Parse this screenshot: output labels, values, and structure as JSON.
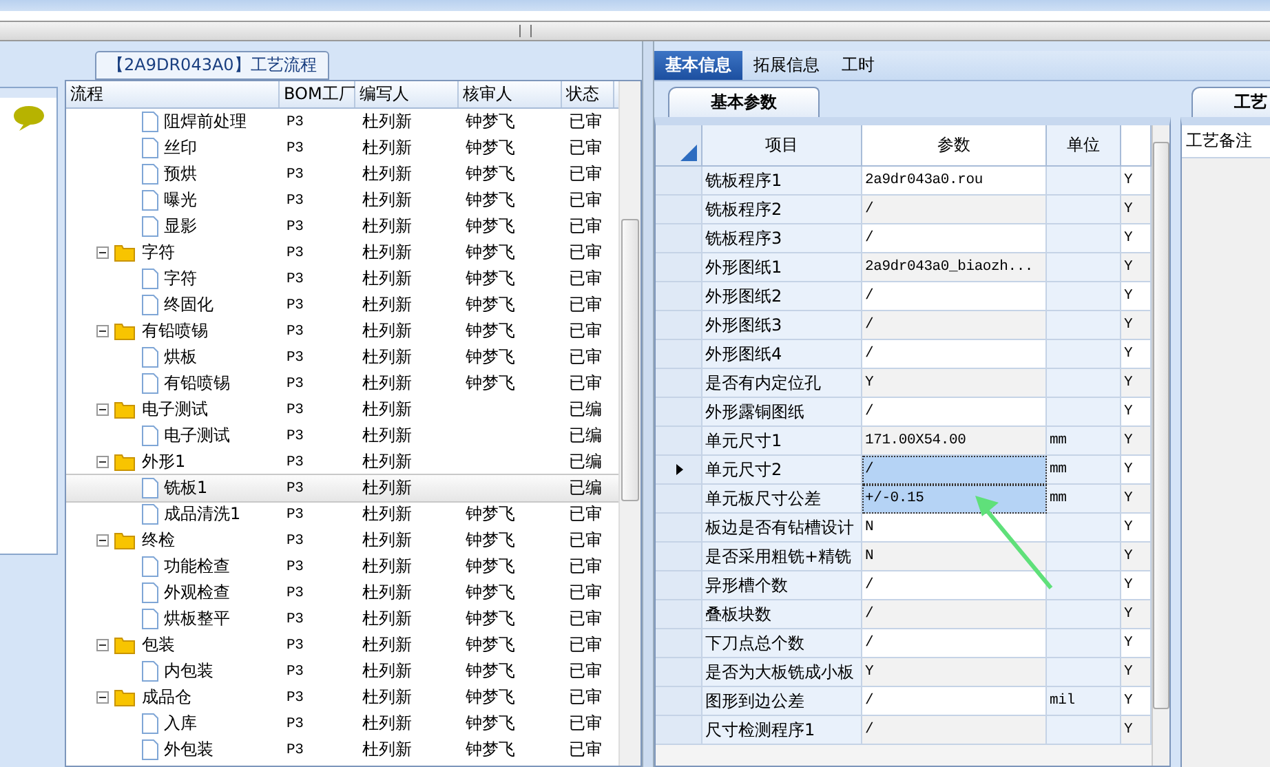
{
  "flow_panel": {
    "title": "【2A9DR043A0】工艺流程",
    "columns": [
      "流程",
      "BOM工厂",
      "编写人",
      "核审人",
      "状态"
    ],
    "continued_children": [
      {
        "name": "阻焊前处理",
        "bom": "P3",
        "writer": "杜列新",
        "reviewer": "钟梦飞",
        "status": "已审",
        "selected": false
      },
      {
        "name": "丝印",
        "bom": "P3",
        "writer": "杜列新",
        "reviewer": "钟梦飞",
        "status": "已审",
        "selected": false
      },
      {
        "name": "预烘",
        "bom": "P3",
        "writer": "杜列新",
        "reviewer": "钟梦飞",
        "status": "已审",
        "selected": false
      },
      {
        "name": "曝光",
        "bom": "P3",
        "writer": "杜列新",
        "reviewer": "钟梦飞",
        "status": "已审",
        "selected": false
      },
      {
        "name": "显影",
        "bom": "P3",
        "writer": "杜列新",
        "reviewer": "钟梦飞",
        "status": "已审",
        "selected": false
      }
    ],
    "groups": [
      {
        "name": "字符",
        "bom": "P3",
        "writer": "杜列新",
        "reviewer": "钟梦飞",
        "status": "已审",
        "expanded": true,
        "children": [
          {
            "name": "字符",
            "bom": "P3",
            "writer": "杜列新",
            "reviewer": "钟梦飞",
            "status": "已审",
            "selected": false
          },
          {
            "name": "终固化",
            "bom": "P3",
            "writer": "杜列新",
            "reviewer": "钟梦飞",
            "status": "已审",
            "selected": false
          }
        ]
      },
      {
        "name": "有铅喷锡",
        "bom": "P3",
        "writer": "杜列新",
        "reviewer": "钟梦飞",
        "status": "已审",
        "expanded": true,
        "children": [
          {
            "name": "烘板",
            "bom": "P3",
            "writer": "杜列新",
            "reviewer": "钟梦飞",
            "status": "已审",
            "selected": false
          },
          {
            "name": "有铅喷锡",
            "bom": "P3",
            "writer": "杜列新",
            "reviewer": "钟梦飞",
            "status": "已审",
            "selected": false
          }
        ]
      },
      {
        "name": "电子测试",
        "bom": "P3",
        "writer": "杜列新",
        "status": "已编",
        "expanded": true,
        "children": [
          {
            "name": "电子测试",
            "bom": "P3",
            "writer": "杜列新",
            "status": "已编",
            "selected": false
          }
        ]
      },
      {
        "name": "外形1",
        "bom": "P3",
        "writer": "杜列新",
        "status": "已编",
        "expanded": true,
        "children": [
          {
            "name": "铣板1",
            "bom": "P3",
            "writer": "杜列新",
            "status": "已编",
            "selected": true
          },
          {
            "name": "成品清洗1",
            "bom": "P3",
            "writer": "杜列新",
            "reviewer": "钟梦飞",
            "status": "已审",
            "selected": false
          }
        ]
      },
      {
        "name": "终检",
        "bom": "P3",
        "writer": "杜列新",
        "reviewer": "钟梦飞",
        "status": "已审",
        "expanded": true,
        "children": [
          {
            "name": "功能检查",
            "bom": "P3",
            "writer": "杜列新",
            "reviewer": "钟梦飞",
            "status": "已审",
            "selected": false
          },
          {
            "name": "外观检查",
            "bom": "P3",
            "writer": "杜列新",
            "reviewer": "钟梦飞",
            "status": "已审",
            "selected": false
          },
          {
            "name": "烘板整平",
            "bom": "P3",
            "writer": "杜列新",
            "reviewer": "钟梦飞",
            "status": "已审",
            "selected": false
          }
        ]
      },
      {
        "name": "包装",
        "bom": "P3",
        "writer": "杜列新",
        "reviewer": "钟梦飞",
        "status": "已审",
        "expanded": true,
        "children": [
          {
            "name": "内包装",
            "bom": "P3",
            "writer": "杜列新",
            "reviewer": "钟梦飞",
            "status": "已审",
            "selected": false
          }
        ]
      },
      {
        "name": "成品仓",
        "bom": "P3",
        "writer": "杜列新",
        "reviewer": "钟梦飞",
        "status": "已审",
        "expanded": true,
        "children": [
          {
            "name": "入库",
            "bom": "P3",
            "writer": "杜列新",
            "reviewer": "钟梦飞",
            "status": "已审",
            "selected": false
          },
          {
            "name": "外包装",
            "bom": "P3",
            "writer": "杜列新",
            "reviewer": "钟梦飞",
            "status": "已审",
            "selected": false
          }
        ]
      }
    ]
  },
  "tabs": [
    {
      "label": "基本信息",
      "selected": true
    },
    {
      "label": "拓展信息",
      "selected": false
    },
    {
      "label": "工时",
      "selected": false
    }
  ],
  "sub_tab": "基本参数",
  "params": {
    "columns": [
      "项目",
      "参数",
      "单位"
    ],
    "rows": [
      {
        "item": "铣板程序1",
        "value": "2a9dr043a0.rou",
        "column_4": "Y",
        "selected": false,
        "highlighted": false
      },
      {
        "item": "铣板程序2",
        "value": "/",
        "column_4": "Y",
        "selected": false,
        "highlighted": false
      },
      {
        "item": "铣板程序3",
        "value": "/",
        "column_4": "Y",
        "selected": false,
        "highlighted": false
      },
      {
        "item": "外形图纸1",
        "value": "2a9dr043a0_biaozh...",
        "column_4": "Y",
        "selected": false,
        "highlighted": false
      },
      {
        "item": "外形图纸2",
        "value": "/",
        "column_4": "Y",
        "selected": false,
        "highlighted": false
      },
      {
        "item": "外形图纸3",
        "value": "/",
        "column_4": "Y",
        "selected": false,
        "highlighted": false
      },
      {
        "item": "外形图纸4",
        "value": "/",
        "column_4": "Y",
        "selected": false,
        "highlighted": false
      },
      {
        "item": "是否有内定位孔",
        "value": "Y",
        "column_4": "Y",
        "selected": false,
        "highlighted": false
      },
      {
        "item": "外形露铜图纸",
        "value": "/",
        "column_4": "Y",
        "selected": false,
        "highlighted": false
      },
      {
        "item": "单元尺寸1",
        "value": "171.00X54.00",
        "unit": "mm",
        "column_4": "Y",
        "selected": false,
        "highlighted": false
      },
      {
        "item": "单元尺寸2",
        "value": "/",
        "unit": "mm",
        "column_4": "Y",
        "selected": true,
        "highlighted": true
      },
      {
        "item": "单元板尺寸公差",
        "value": "+/-0.15",
        "unit": "mm",
        "column_4": "Y",
        "selected": false,
        "highlighted": true
      },
      {
        "item": "板边是否有钻槽设计",
        "value": "N",
        "column_4": "Y",
        "selected": false,
        "highlighted": false
      },
      {
        "item": "是否采用粗铣+精铣",
        "value": "N",
        "column_4": "Y",
        "selected": false,
        "highlighted": false
      },
      {
        "item": "异形槽个数",
        "value": "/",
        "column_4": "Y",
        "selected": false,
        "highlighted": false
      },
      {
        "item": "叠板块数",
        "value": "/",
        "column_4": "Y",
        "selected": false,
        "highlighted": false
      },
      {
        "item": "下刀点总个数",
        "value": "/",
        "column_4": "Y",
        "selected": false,
        "highlighted": false
      },
      {
        "item": "是否为大板铣成小板",
        "value": "Y",
        "column_4": "Y",
        "selected": false,
        "highlighted": false
      },
      {
        "item": "图形到边公差",
        "value": "/",
        "unit": "mil",
        "column_4": "Y",
        "selected": false,
        "highlighted": false
      },
      {
        "item": "尺寸检测程序1",
        "value": "/",
        "column_4": "Y",
        "selected": false,
        "highlighted": false
      }
    ]
  },
  "side_panel": {
    "tab": "工艺",
    "label": "工艺备注"
  }
}
